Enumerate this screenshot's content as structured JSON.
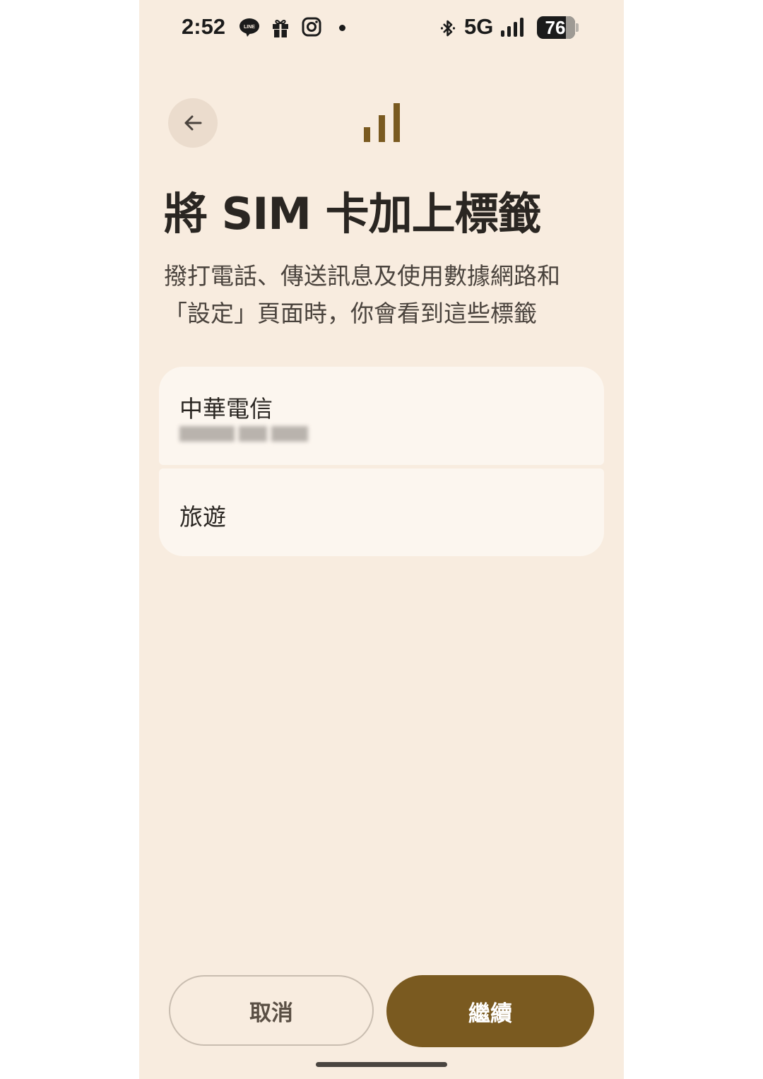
{
  "status_bar": {
    "time": "2:52",
    "line_icon_text": "LINE",
    "network": "5G",
    "battery": "76",
    "battery_level_percent": 76
  },
  "header": {
    "back_icon": "arrow-left-icon",
    "hero_icon": "signal-bars-icon",
    "accent_color": "#7a5a20"
  },
  "title": "將 SIM 卡加上標籤",
  "description": "撥打電話、傳送訊息及使用數據網路和「設定」頁面時，你會看到這些標籤",
  "sim_cards": [
    {
      "name": "中華電信",
      "number_obscured": true
    },
    {
      "name": "旅遊"
    }
  ],
  "buttons": {
    "cancel": "取消",
    "continue": "繼續"
  }
}
